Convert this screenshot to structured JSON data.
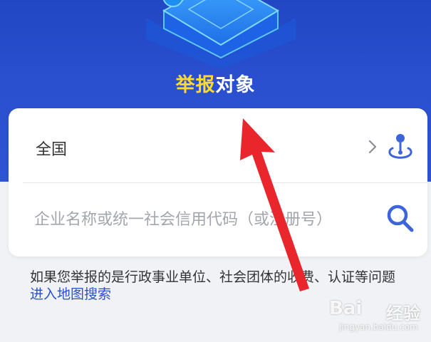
{
  "header": {
    "title_highlight": "举报",
    "title_rest": "对象"
  },
  "region": {
    "label": "全国",
    "chevron_icon": "chevron-right-icon",
    "location_icon": "location-pin-icon"
  },
  "search": {
    "placeholder": "企业名称或统一社会信用代码（或注册号）",
    "icon": "search-icon"
  },
  "notice": {
    "text": "如果您举报的是行政事业单位、社会团体的收费、认证等问题",
    "link": "进入地图搜索"
  },
  "watermark": {
    "logo": "Bai",
    "brand": "经验",
    "url": "jingyan.baidu.com"
  },
  "colors": {
    "header_blue": "#2a4fcf",
    "highlight_yellow": "#ffd92e",
    "icon_blue": "#3d64d9",
    "annotation_red": "#e8262c"
  }
}
